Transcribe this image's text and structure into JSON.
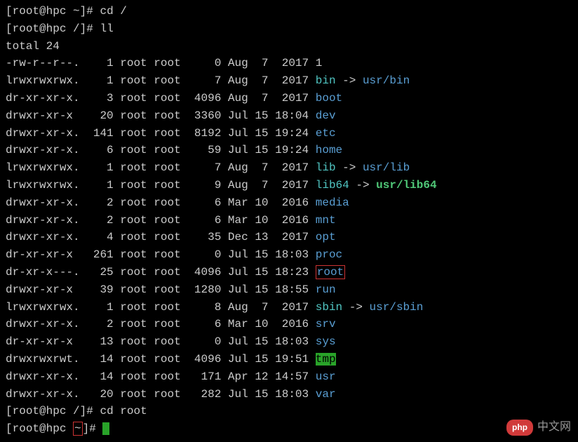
{
  "prompts": [
    {
      "user": "root",
      "host": "hpc",
      "path": "~",
      "cmd": "cd /"
    },
    {
      "user": "root",
      "host": "hpc",
      "path": "/",
      "cmd": "ll"
    }
  ],
  "total_line": "total 24",
  "entries": [
    {
      "perms": "-rw-r--r--.",
      "links": "1",
      "owner": "root",
      "group": "root",
      "size": "0",
      "date": "Aug  7  2017",
      "name": "1",
      "class": "file-reg"
    },
    {
      "perms": "lrwxrwxrwx.",
      "links": "1",
      "owner": "root",
      "group": "root",
      "size": "7",
      "date": "Aug  7  2017",
      "name": "bin",
      "class": "file-link",
      "target": "usr/bin"
    },
    {
      "perms": "dr-xr-xr-x.",
      "links": "3",
      "owner": "root",
      "group": "root",
      "size": "4096",
      "date": "Aug  7  2017",
      "name": "boot",
      "class": "file-dir"
    },
    {
      "perms": "drwxr-xr-x",
      "links": "20",
      "owner": "root",
      "group": "root",
      "size": "3360",
      "date": "Jul 15 18:04",
      "name": "dev",
      "class": "file-dir"
    },
    {
      "perms": "drwxr-xr-x.",
      "links": "141",
      "owner": "root",
      "group": "root",
      "size": "8192",
      "date": "Jul 15 19:24",
      "name": "etc",
      "class": "file-dir"
    },
    {
      "perms": "drwxr-xr-x.",
      "links": "6",
      "owner": "root",
      "group": "root",
      "size": "59",
      "date": "Jul 15 19:24",
      "name": "home",
      "class": "file-dir"
    },
    {
      "perms": "lrwxrwxrwx.",
      "links": "1",
      "owner": "root",
      "group": "root",
      "size": "7",
      "date": "Aug  7  2017",
      "name": "lib",
      "class": "file-link",
      "target": "usr/lib"
    },
    {
      "perms": "lrwxrwxrwx.",
      "links": "1",
      "owner": "root",
      "group": "root",
      "size": "9",
      "date": "Aug  7  2017",
      "name": "lib64",
      "class": "file-link",
      "target": "usr/lib64",
      "target_highlight": true
    },
    {
      "perms": "drwxr-xr-x.",
      "links": "2",
      "owner": "root",
      "group": "root",
      "size": "6",
      "date": "Mar 10  2016",
      "name": "media",
      "class": "file-dir"
    },
    {
      "perms": "drwxr-xr-x.",
      "links": "2",
      "owner": "root",
      "group": "root",
      "size": "6",
      "date": "Mar 10  2016",
      "name": "mnt",
      "class": "file-dir"
    },
    {
      "perms": "drwxr-xr-x.",
      "links": "4",
      "owner": "root",
      "group": "root",
      "size": "35",
      "date": "Dec 13  2017",
      "name": "opt",
      "class": "file-dir"
    },
    {
      "perms": "dr-xr-xr-x",
      "links": "261",
      "owner": "root",
      "group": "root",
      "size": "0",
      "date": "Jul 15 18:03",
      "name": "proc",
      "class": "file-dir"
    },
    {
      "perms": "dr-xr-x---.",
      "links": "25",
      "owner": "root",
      "group": "root",
      "size": "4096",
      "date": "Jul 15 18:23",
      "name": "root",
      "class": "file-dir",
      "boxed": true
    },
    {
      "perms": "drwxr-xr-x",
      "links": "39",
      "owner": "root",
      "group": "root",
      "size": "1280",
      "date": "Jul 15 18:55",
      "name": "run",
      "class": "file-dir"
    },
    {
      "perms": "lrwxrwxrwx.",
      "links": "1",
      "owner": "root",
      "group": "root",
      "size": "8",
      "date": "Aug  7  2017",
      "name": "sbin",
      "class": "file-link",
      "target": "usr/sbin"
    },
    {
      "perms": "drwxr-xr-x.",
      "links": "2",
      "owner": "root",
      "group": "root",
      "size": "6",
      "date": "Mar 10  2016",
      "name": "srv",
      "class": "file-dir"
    },
    {
      "perms": "dr-xr-xr-x",
      "links": "13",
      "owner": "root",
      "group": "root",
      "size": "0",
      "date": "Jul 15 18:03",
      "name": "sys",
      "class": "file-dir"
    },
    {
      "perms": "drwxrwxrwt.",
      "links": "14",
      "owner": "root",
      "group": "root",
      "size": "4096",
      "date": "Jul 15 19:51",
      "name": "tmp",
      "class": "file-sticky"
    },
    {
      "perms": "drwxr-xr-x.",
      "links": "14",
      "owner": "root",
      "group": "root",
      "size": "171",
      "date": "Apr 12 14:57",
      "name": "usr",
      "class": "file-dir"
    },
    {
      "perms": "drwxr-xr-x.",
      "links": "20",
      "owner": "root",
      "group": "root",
      "size": "282",
      "date": "Jul 15 18:03",
      "name": "var",
      "class": "file-dir"
    }
  ],
  "tail_prompts": [
    {
      "user": "root",
      "host": "hpc",
      "path": "/",
      "cmd": "cd root"
    },
    {
      "user": "root",
      "host": "hpc",
      "path": "~",
      "cmd": "",
      "cursor": true,
      "path_boxed": true
    }
  ],
  "watermark": {
    "logo": "php",
    "text": "中文网"
  }
}
